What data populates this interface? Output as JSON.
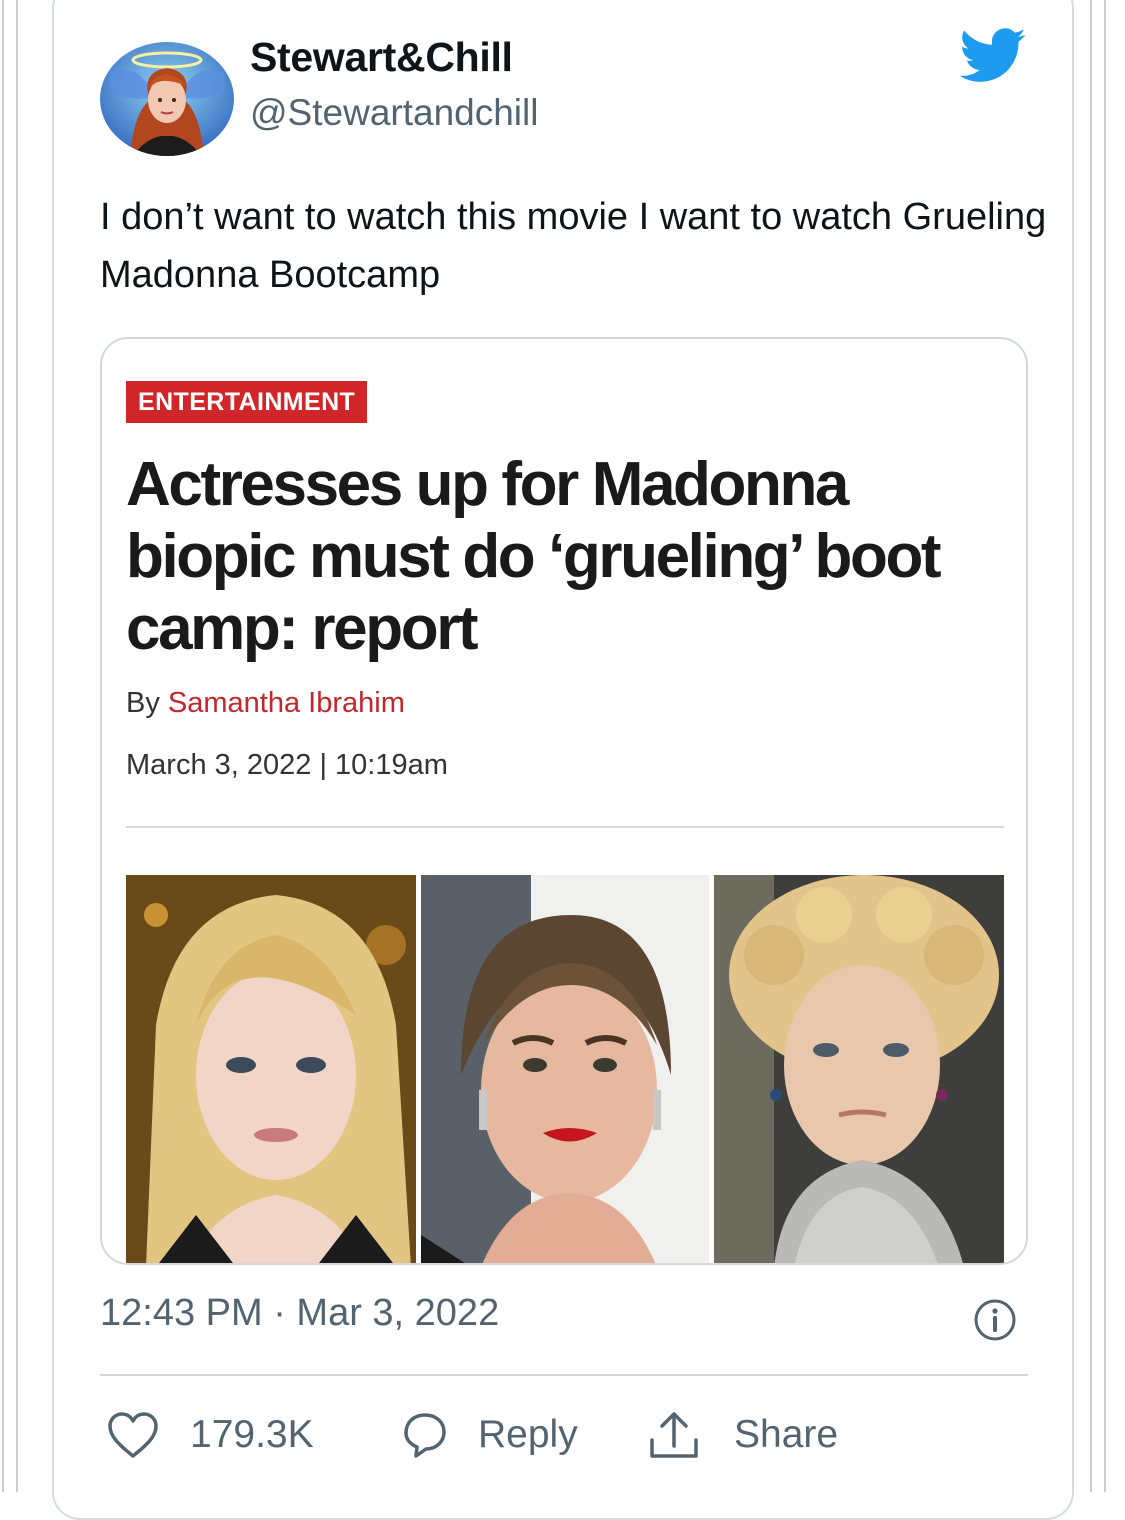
{
  "tweet": {
    "display_name": "Stewart&Chill",
    "handle": "@Stewartandchill",
    "text": "I don’t want to watch this movie I want to watch Grueling Madonna Bootcamp",
    "timestamp": "12:43 PM · Mar 3, 2022",
    "icons": {
      "brand": "twitter-bird-icon",
      "info": "info-icon",
      "like": "heart-icon",
      "reply": "speech-bubble-icon",
      "share": "share-upload-icon"
    },
    "colors": {
      "brand_blue": "#1d9bf0",
      "secondary_text": "#536471"
    }
  },
  "embed": {
    "category": "ENTERTAINMENT",
    "category_color": "#d0262a",
    "headline": "Actresses up for Madonna biopic must do ‘grueling’ boot camp: report",
    "byline_prefix": "By ",
    "author": "Samantha Ibrahim",
    "author_color": "#c2272d",
    "date": "March 3, 2022 | 10:19am"
  },
  "actions": {
    "likes": "179.3K",
    "reply_label": "Reply",
    "share_label": "Share"
  }
}
